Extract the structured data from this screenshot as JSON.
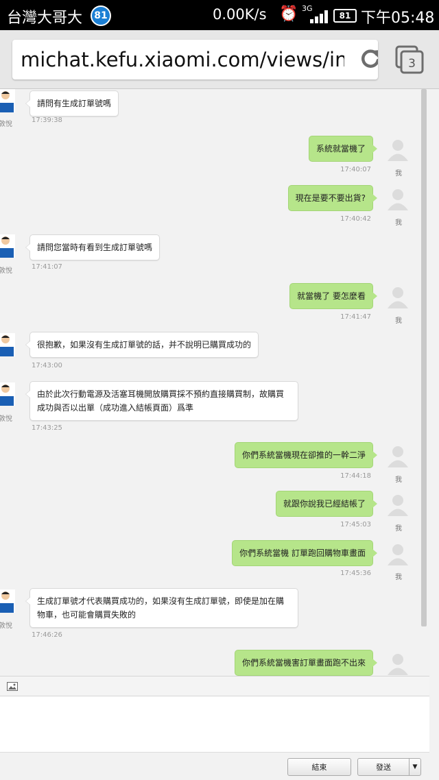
{
  "status_bar": {
    "carrier": "台灣大哥大",
    "notification_count": "81",
    "speed": "0.00K/s",
    "network": "3G",
    "battery": "81",
    "time": "下午05:48"
  },
  "browser": {
    "url": "michat.kefu.xiaomi.com/views/index",
    "tab_count": "3"
  },
  "chat": {
    "agent_name": "敦悅",
    "me_label": "我",
    "messages": [
      {
        "from": "agent",
        "text": "請問有生成訂單號嗎",
        "time": "17:39:38"
      },
      {
        "from": "me",
        "text": "系統就當機了",
        "time": "17:40:07"
      },
      {
        "from": "me",
        "text": "現在是要不要出貨?",
        "time": "17:40:42"
      },
      {
        "from": "agent",
        "text": "請問您當時有看到生成訂單號嗎",
        "time": "17:41:07"
      },
      {
        "from": "me",
        "text": "就當機了 要怎麼看",
        "time": "17:41:47"
      },
      {
        "from": "agent",
        "text": "很抱歉，如果沒有生成訂單號的話，并不說明已購買成功的",
        "time": "17:43:00"
      },
      {
        "from": "agent",
        "text": "由於此次行動電源及活塞耳機開放購買採不預約直接購買制，故購買成功與否以出單（成功進入結帳頁面）爲準",
        "time": "17:43:25"
      },
      {
        "from": "me",
        "text": "你們系統當機現在卻推的一幹二淨",
        "time": "17:44:18"
      },
      {
        "from": "me",
        "text": "就跟你說我已經結帳了",
        "time": "17:45:03"
      },
      {
        "from": "me",
        "text": "你們系統當機 訂單跑回購物車畫面",
        "time": "17:45:36"
      },
      {
        "from": "agent",
        "text": "生成訂單號才代表購買成功的，如果沒有生成訂單號，即使是加在購物車，也可能會購買失敗的",
        "time": "17:46:26"
      },
      {
        "from": "me",
        "text": "你們系統當機害訂單畫面跑不出來",
        "time": ""
      }
    ]
  },
  "composer": {
    "end_button": "結束",
    "send_button": "發送",
    "dropdown_arrow": "▼"
  },
  "colors": {
    "outgoing_bubble": "#b6e58a",
    "incoming_bubble": "#ffffff",
    "accent_badge": "#1b7fd4"
  }
}
